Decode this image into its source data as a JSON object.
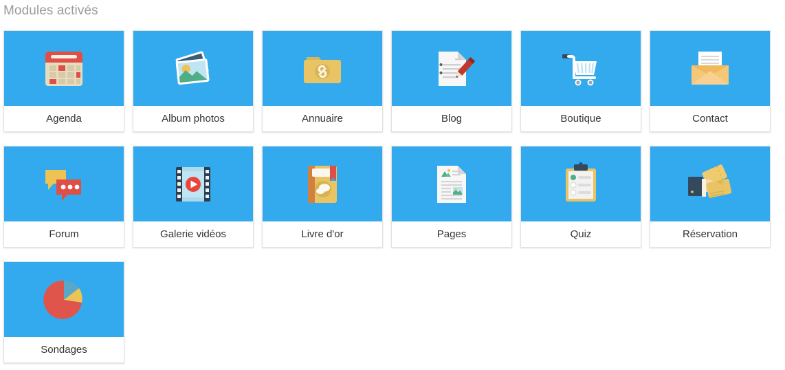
{
  "section": {
    "title": "Modules activés"
  },
  "theme": {
    "tile_icon_bg": "#33aaee",
    "tile_bg": "#ffffff",
    "tile_border": "#e2e2e2",
    "title_color": "#9b9b9b",
    "label_color": "#333333"
  },
  "modules": [
    {
      "label": "Agenda",
      "icon": "calendar-icon"
    },
    {
      "label": "Album photos",
      "icon": "photos-icon"
    },
    {
      "label": "Annuaire",
      "icon": "folder-link-icon"
    },
    {
      "label": "Blog",
      "icon": "document-pencil-icon"
    },
    {
      "label": "Boutique",
      "icon": "shopping-cart-icon"
    },
    {
      "label": "Contact",
      "icon": "envelope-letter-icon"
    },
    {
      "label": "Forum",
      "icon": "speech-bubbles-icon"
    },
    {
      "label": "Galerie vidéos",
      "icon": "film-play-icon"
    },
    {
      "label": "Livre d'or",
      "icon": "book-bookmark-icon"
    },
    {
      "label": "Pages",
      "icon": "document-image-icon"
    },
    {
      "label": "Quiz",
      "icon": "clipboard-checklist-icon"
    },
    {
      "label": "Réservation",
      "icon": "hand-tickets-icon"
    },
    {
      "label": "Sondages",
      "icon": "pie-chart-icon"
    }
  ]
}
